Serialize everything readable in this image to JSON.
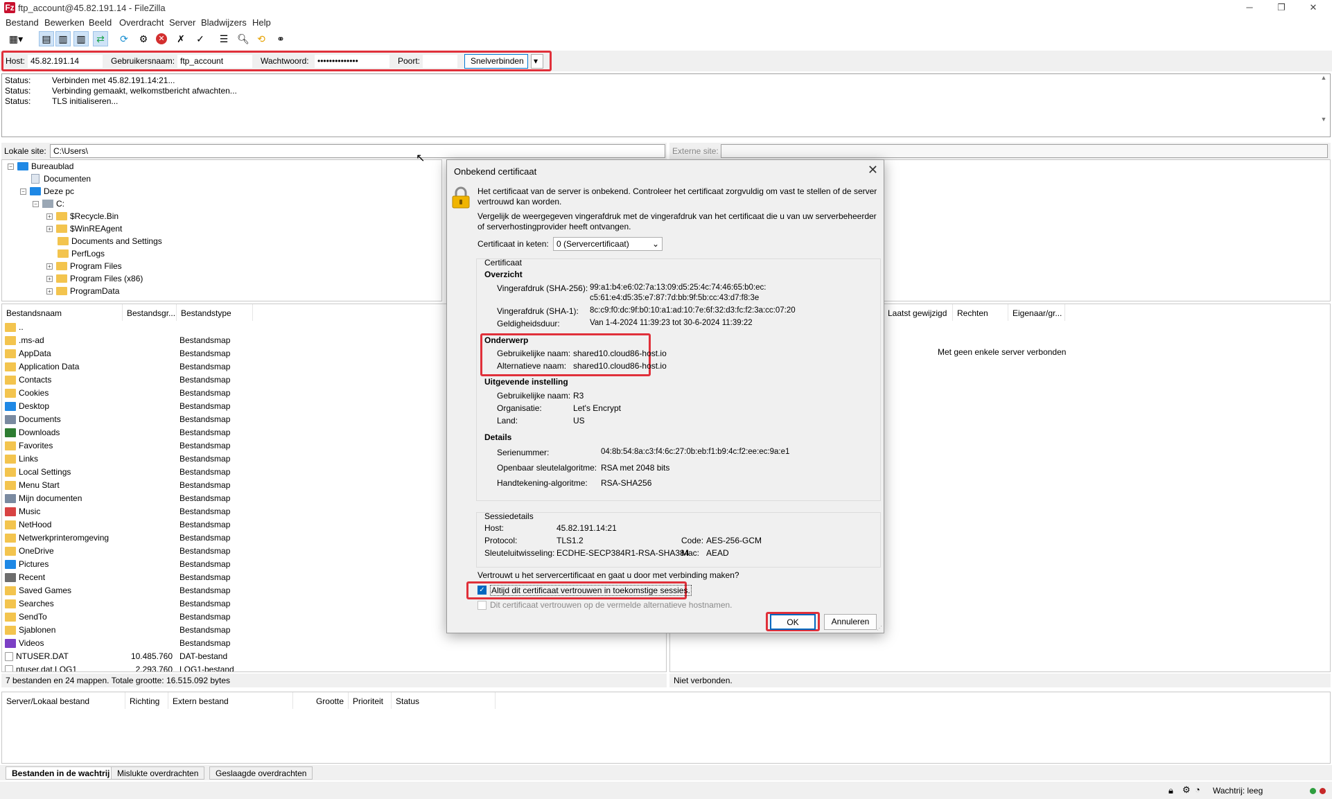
{
  "window": {
    "title": "ftp_account@45.82.191.14 - FileZilla",
    "app_icon": "Fz"
  },
  "menu": [
    "Bestand",
    "Bewerken",
    "Beeld",
    "Overdracht",
    "Server",
    "Bladwijzers",
    "Help"
  ],
  "quickconnect": {
    "host_label": "Host:",
    "host_value": "45.82.191.14",
    "user_label": "Gebruikersnaam:",
    "user_value": "ftp_account",
    "password_label": "Wachtwoord:",
    "password_value": "••••••••••••••",
    "port_label": "Poort:",
    "port_value": "",
    "connect_button": "Snelverbinden"
  },
  "log": [
    {
      "key": "Status:",
      "msg": "Verbinden met 45.82.191.14:21..."
    },
    {
      "key": "Status:",
      "msg": "Verbinding gemaakt, welkomstbericht afwachten..."
    },
    {
      "key": "Status:",
      "msg": "TLS initialiseren..."
    }
  ],
  "local": {
    "site_label": "Lokale site:",
    "site_path": "C:\\Users\\",
    "tree": [
      {
        "label": "Bureaublad"
      },
      {
        "label": "Documenten"
      },
      {
        "label": "Deze pc"
      },
      {
        "label": "C:"
      },
      {
        "label": "$Recycle.Bin"
      },
      {
        "label": "$WinREAgent"
      },
      {
        "label": "Documents and Settings"
      },
      {
        "label": "PerfLogs"
      },
      {
        "label": "Program Files"
      },
      {
        "label": "Program Files (x86)"
      },
      {
        "label": "ProgramData"
      }
    ],
    "columns": [
      "Bestandsnaam",
      "Bestandsgr...",
      "Bestandstype"
    ],
    "files": [
      {
        "name": "..",
        "size": "",
        "type": ""
      },
      {
        "name": ".ms-ad",
        "size": "",
        "type": "Bestandsmap"
      },
      {
        "name": "AppData",
        "size": "",
        "type": "Bestandsmap"
      },
      {
        "name": "Application Data",
        "size": "",
        "type": "Bestandsmap"
      },
      {
        "name": "Contacts",
        "size": "",
        "type": "Bestandsmap"
      },
      {
        "name": "Cookies",
        "size": "",
        "type": "Bestandsmap"
      },
      {
        "name": "Desktop",
        "size": "",
        "type": "Bestandsmap"
      },
      {
        "name": "Documents",
        "size": "",
        "type": "Bestandsmap"
      },
      {
        "name": "Downloads",
        "size": "",
        "type": "Bestandsmap"
      },
      {
        "name": "Favorites",
        "size": "",
        "type": "Bestandsmap"
      },
      {
        "name": "Links",
        "size": "",
        "type": "Bestandsmap"
      },
      {
        "name": "Local Settings",
        "size": "",
        "type": "Bestandsmap"
      },
      {
        "name": "Menu Start",
        "size": "",
        "type": "Bestandsmap"
      },
      {
        "name": "Mijn documenten",
        "size": "",
        "type": "Bestandsmap"
      },
      {
        "name": "Music",
        "size": "",
        "type": "Bestandsmap"
      },
      {
        "name": "NetHood",
        "size": "",
        "type": "Bestandsmap"
      },
      {
        "name": "Netwerkprinteromgeving",
        "size": "",
        "type": "Bestandsmap"
      },
      {
        "name": "OneDrive",
        "size": "",
        "type": "Bestandsmap"
      },
      {
        "name": "Pictures",
        "size": "",
        "type": "Bestandsmap"
      },
      {
        "name": "Recent",
        "size": "",
        "type": "Bestandsmap"
      },
      {
        "name": "Saved Games",
        "size": "",
        "type": "Bestandsmap"
      },
      {
        "name": "Searches",
        "size": "",
        "type": "Bestandsmap"
      },
      {
        "name": "SendTo",
        "size": "",
        "type": "Bestandsmap"
      },
      {
        "name": "Sjablonen",
        "size": "",
        "type": "Bestandsmap"
      },
      {
        "name": "Videos",
        "size": "",
        "type": "Bestandsmap"
      },
      {
        "name": "NTUSER.DAT",
        "size": "10.485.760",
        "type": "DAT-bestand"
      },
      {
        "name": "ntuser.dat.LOG1",
        "size": "2.293.760",
        "type": "LOG1-bestand"
      }
    ],
    "status": "7 bestanden en 24 mappen. Totale grootte: 16.515.092 bytes"
  },
  "remote": {
    "site_label": "Externe site:",
    "columns": [
      "Laatst gewijzigd",
      "Rechten",
      "Eigenaar/gr..."
    ],
    "empty_message": "Met geen enkele server verbonden",
    "status": "Niet verbonden."
  },
  "queue": {
    "columns": [
      "Server/Lokaal bestand",
      "Richting",
      "Extern bestand",
      "Grootte",
      "Prioriteit",
      "Status"
    ],
    "tabs": [
      "Bestanden in de wachtrij",
      "Mislukte overdrachten",
      "Geslaagde overdrachten"
    ],
    "status": "Wachtrij: leeg"
  },
  "dialog": {
    "title": "Onbekend certificaat",
    "intro": "Het certificaat van de server is onbekend. Controleer het certificaat zorgvuldig om vast te stellen of de server vertrouwd kan worden.",
    "compare": "Vergelijk de weergegeven vingerafdruk met de vingerafdruk van het certificaat die u van uw serverbeheerder of serverhostingprovider heeft ontvangen.",
    "chain_label": "Certificaat in keten:",
    "chain_value": "0 (Servercertificaat)",
    "cert_group": "Certificaat",
    "overview": "Overzicht",
    "sha256_label": "Vingerafdruk (SHA-256):",
    "sha256_line1": "99:a1:b4:e6:02:7a:13:09:d5:25:4c:74:46:65:b0:ec:",
    "sha256_line2": "c5:61:e4:d5:35:e7:87:7d:bb:9f:5b:cc:43:d7:f8:3e",
    "sha1_label": "Vingerafdruk (SHA-1):",
    "sha1_value": "8c:c9:f0:dc:9f:b0:10:a1:ad:10:7e:6f:32:d3:fc:f2:3a:cc:07:20",
    "validity_label": "Geldigheidsduur:",
    "validity_value": "Van 1-4-2024 11:39:23 tot 30-6-2024 11:39:22",
    "subject": "Onderwerp",
    "cn_label": "Gebruikelijke naam:",
    "cn_value": "shared10.cloud86-host.io",
    "alt_label": "Alternatieve naam:",
    "alt_value": "shared10.cloud86-host.io",
    "issuer": "Uitgevende instelling",
    "issuer_cn_label": "Gebruikelijke naam:",
    "issuer_cn_value": "R3",
    "org_label": "Organisatie:",
    "org_value": "Let's Encrypt",
    "country_label": "Land:",
    "country_value": "US",
    "details": "Details",
    "serial_label": "Serienummer:",
    "serial_value": "04:8b:54:8a:c3:f4:6c:27:0b:eb:f1:b9:4c:f2:ee:ec:9a:e1",
    "pubkey_label": "Openbaar sleutelalgoritme:",
    "pubkey_value": "RSA met 2048 bits",
    "sigalg_label": "Handtekening-algoritme:",
    "sigalg_value": "RSA-SHA256",
    "session_group": "Sessiedetails",
    "s_host_label": "Host:",
    "s_host_value": "45.82.191.14:21",
    "s_proto_label": "Protocol:",
    "s_proto_value": "TLS1.2",
    "s_code_label": "Code:",
    "s_code_value": "AES-256-GCM",
    "s_kex_label": "Sleuteluitwisseling:",
    "s_kex_value": "ECDHE-SECP384R1-RSA-SHA384",
    "s_mac_label": "Mac:",
    "s_mac_value": "AEAD",
    "question": "Vertrouwt u het servercertificaat en gaat u door met verbinding maken?",
    "always_trust": "Altijd dit certificaat vertrouwen in toekomstige sessies.",
    "always_trust_checked": true,
    "trust_alt": "Dit certificaat vertrouwen op de vermelde alternatieve hostnamen.",
    "ok": "OK",
    "cancel": "Annuleren"
  },
  "colors": {
    "highlight": "#e0303a",
    "accent": "#0067c0",
    "folder": "#f3c44e"
  }
}
